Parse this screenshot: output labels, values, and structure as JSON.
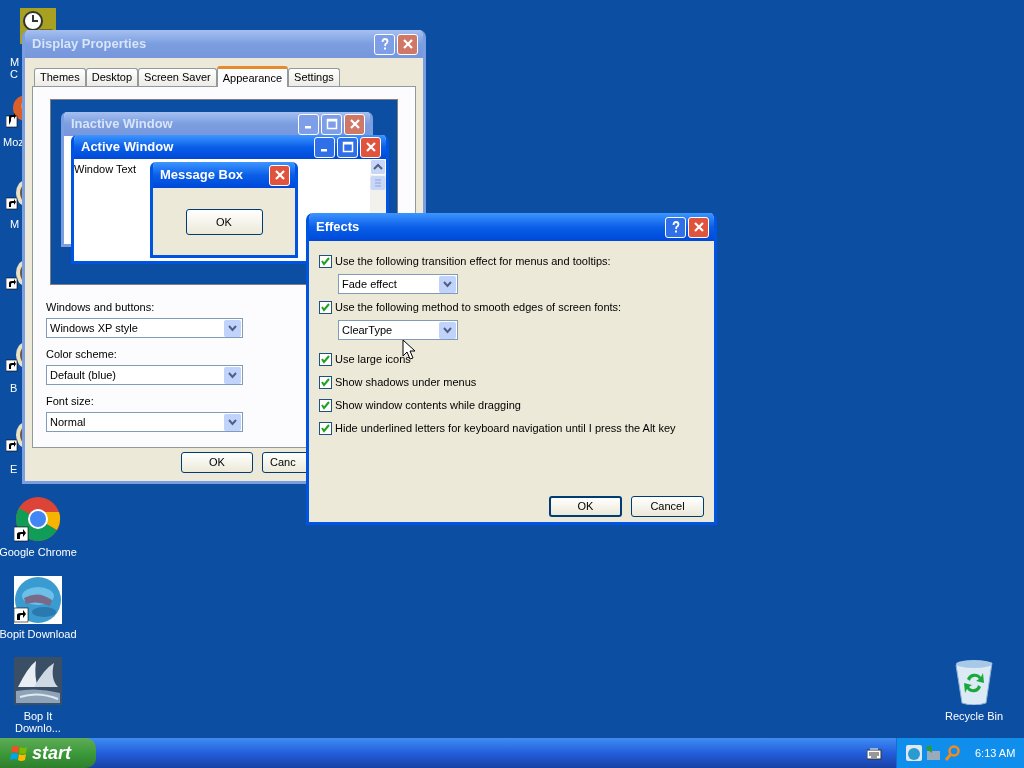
{
  "desktop_icons": [
    {
      "kind": "clock",
      "label": [
        "M",
        "C"
      ]
    },
    {
      "kind": "browser",
      "label": [
        "Moz"
      ]
    },
    {
      "kind": "shortcut",
      "label": [
        "M"
      ]
    },
    {
      "kind": "shortcut"
    },
    {
      "kind": "shortcut",
      "label": [
        "B"
      ]
    },
    {
      "kind": "shortcut",
      "label": [
        "E"
      ]
    },
    {
      "kind": "chrome",
      "label": [
        "Google Chrome"
      ]
    },
    {
      "kind": "bopit",
      "label": [
        "Bopit Download"
      ]
    },
    {
      "kind": "sail",
      "label": [
        "Bop It",
        "Downlo..."
      ]
    },
    {
      "kind": "recycle",
      "label": [
        "Recycle Bin"
      ]
    }
  ],
  "display_properties": {
    "title": "Display Properties",
    "active": false,
    "tabs": [
      {
        "label": "Themes",
        "selected": false
      },
      {
        "label": "Desktop",
        "selected": false
      },
      {
        "label": "Screen Saver",
        "selected": false
      },
      {
        "label": "Appearance",
        "selected": true
      },
      {
        "label": "Settings",
        "selected": false
      }
    ],
    "preview": {
      "inactive_title": "Inactive Window",
      "active_title": "Active Window",
      "window_text": "Window Text",
      "message_title": "Message Box",
      "message_button": "OK"
    },
    "fields": [
      {
        "label": "Windows and buttons:",
        "value": "Windows XP style"
      },
      {
        "label": "Color scheme:",
        "value": "Default (blue)"
      },
      {
        "label": "Font size:",
        "value": "Normal"
      }
    ],
    "buttons": [
      "OK",
      "Canc"
    ]
  },
  "effects": {
    "title": "Effects",
    "active": true,
    "options": [
      {
        "label": "Use the following transition effect for menus and tooltips:",
        "checked": true,
        "value": "Fade effect"
      },
      {
        "label": "Use the following method to smooth edges of screen fonts:",
        "checked": true,
        "value": "ClearType"
      },
      {
        "label": "Use large icons",
        "checked": true
      },
      {
        "label": "Show shadows under menus",
        "checked": true
      },
      {
        "label": "Show window contents while dragging",
        "checked": true
      },
      {
        "label": "Hide underlined letters for keyboard navigation until I press the Alt key",
        "checked": true
      }
    ],
    "buttons": [
      "OK",
      "Cancel"
    ]
  },
  "taskbar": {
    "start": "start",
    "clock": "6:13 AM"
  }
}
